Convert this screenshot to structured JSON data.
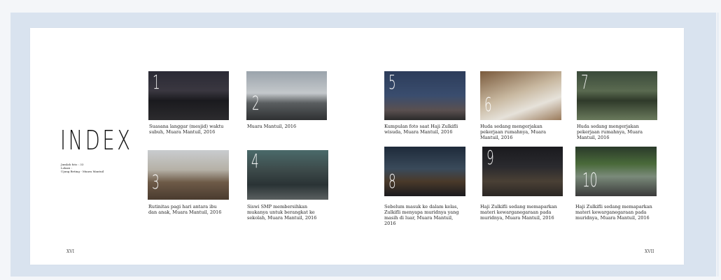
{
  "index": {
    "title": "INDEX",
    "meta": [
      "Jumlah foto : 33",
      "Lokasi :",
      "Ujung Beting - Muara Mantuil"
    ]
  },
  "folio": {
    "left": "XVI",
    "right": "XVII"
  },
  "photos": [
    {
      "number": "1",
      "caption": "Suasana langgar (mesjid) waktu subuh, Muara Mantuil, 2016"
    },
    {
      "number": "2",
      "caption": "Muara Mantuil, 2016"
    },
    {
      "number": "3",
      "caption": "Rutinitas pagi hari antara ibu dan anak, Muara Mantuil, 2016"
    },
    {
      "number": "4",
      "caption": "Siswi SMP membersihkan mukanya untuk berangkat ke sekolah, Muara Mantuil, 2016"
    },
    {
      "number": "5",
      "caption": "Kumpulan foto saat Haji Zulkifli wisuda, Muara Mantuil, 2016"
    },
    {
      "number": "6",
      "caption": "Huda sedang mengerjakan pekerjaan rumahnya, Muara Mantuil, 2016"
    },
    {
      "number": "7",
      "caption": "Huda sedang mengerjakan pekerjaan rumahnya, Muara Mantuil, 2016"
    },
    {
      "number": "8",
      "caption": "Sebelum masuk ke dalam kelas, Zulkifli menyapa muridnya yang masih di luar, Muara Mantuil, 2016"
    },
    {
      "number": "9",
      "caption": "Haji Zulkifli sedang memaparkan materi kewarganegaraan pada muridnya, Muara Mantuil, 2016"
    },
    {
      "number": "10",
      "caption": "Haji Zulkifli sedang memaparkan materi kewarganegaraan pada muridnya, Muara Mantuil, 2016"
    }
  ]
}
